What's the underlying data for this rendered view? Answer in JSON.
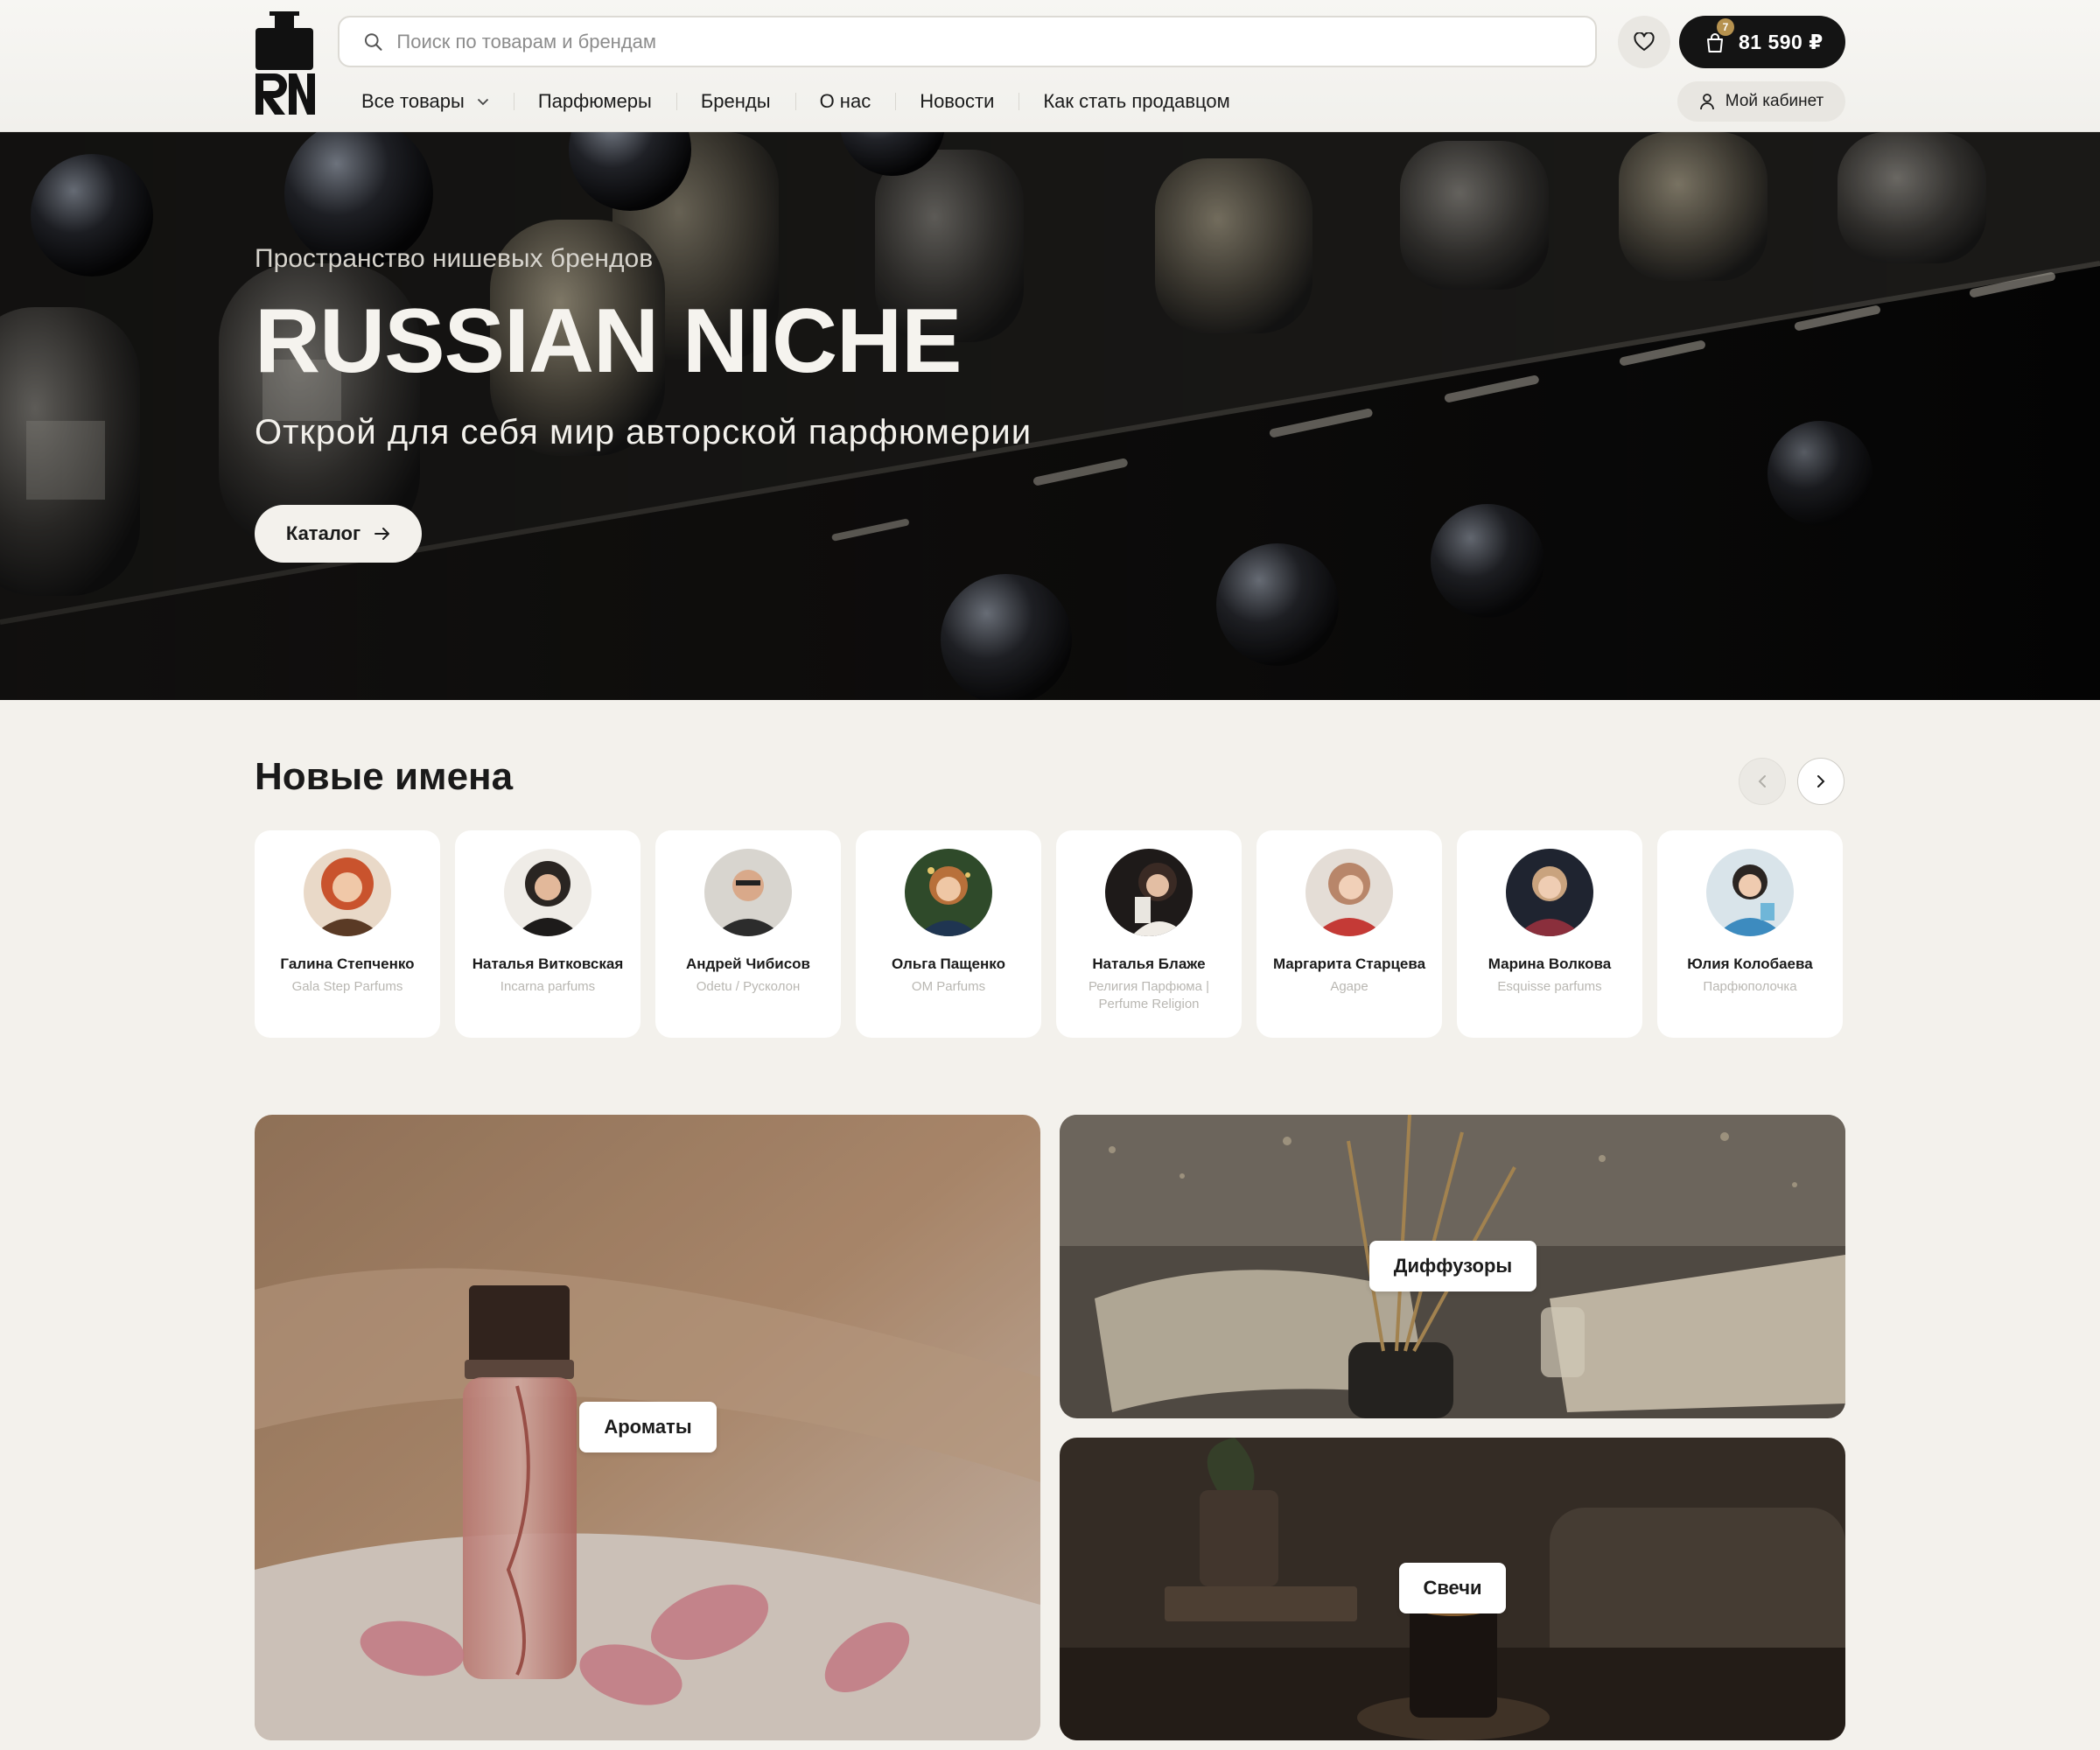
{
  "header": {
    "logo_text": "RN",
    "search": {
      "placeholder": "Поиск по товарам и брендам"
    },
    "cart": {
      "count": "7",
      "total": "81 590 ₽"
    },
    "nav": [
      {
        "label": "Все товары"
      },
      {
        "label": "Парфюмеры"
      },
      {
        "label": "Бренды"
      },
      {
        "label": "О нас"
      },
      {
        "label": "Новости"
      },
      {
        "label": "Как стать продавцом"
      }
    ],
    "account_label": "Мой кабинет"
  },
  "hero": {
    "subtitle": "Пространство нишевых брендов",
    "title": "RUSSIAN NICHE",
    "tagline": "Открой для себя мир авторской парфюмерии",
    "button_label": "Каталог"
  },
  "new_names": {
    "title": "Новые имена",
    "people": [
      {
        "name": "Галина Степченко",
        "brand": "Gala Step Parfums",
        "accent": "#c9532d"
      },
      {
        "name": "Наталья Витковская",
        "brand": "Incarna parfums",
        "accent": "#2a2522"
      },
      {
        "name": "Андрей Чибисов",
        "brand": "Odetu / Русколон",
        "accent": "#3b3b3b"
      },
      {
        "name": "Ольга Пащенко",
        "brand": "OM Parfums",
        "accent": "#2f4a2a"
      },
      {
        "name": "Наталья Блаже",
        "brand": "Религия Парфюма | Perfume Religion",
        "accent": "#2d2623"
      },
      {
        "name": "Маргарита Старцева",
        "brand": "Agape",
        "accent": "#c43a36"
      },
      {
        "name": "Марина Волкова",
        "brand": "Esquisse parfums",
        "accent": "#8a2f3c"
      },
      {
        "name": "Юлия Колобаева",
        "brand": "Парфюполочка",
        "accent": "#3d8bbf"
      }
    ]
  },
  "categories": {
    "aromas": "Ароматы",
    "diffusers": "Диффузоры",
    "candles": "Свечи"
  },
  "colors": {
    "background": "#f3f1ec",
    "dark": "#141414",
    "badge": "#b6924f"
  }
}
